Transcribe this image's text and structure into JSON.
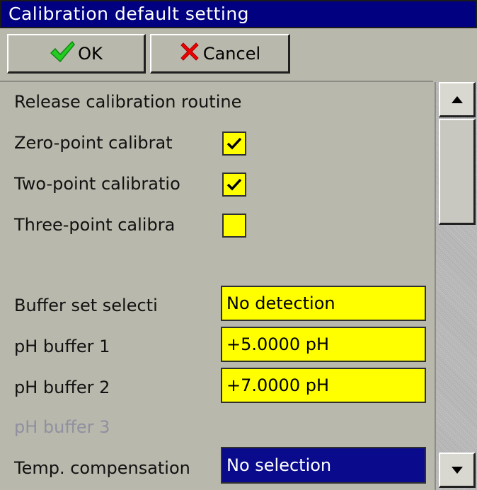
{
  "window": {
    "title": "Calibration default setting"
  },
  "toolbar": {
    "ok_label": "OK",
    "cancel_label": "Cancel"
  },
  "form": {
    "release_label": "Release calibration routine",
    "zero_point": {
      "label": "Zero-point calibrat",
      "checked": true
    },
    "two_point": {
      "label": "Two-point calibratio",
      "checked": true
    },
    "three_point": {
      "label": "Three-point calibra",
      "checked": false
    },
    "buffer_set": {
      "label": "Buffer set selecti",
      "value": "No detection"
    },
    "ph_buffer_1": {
      "label": "pH buffer 1",
      "value": "+5.0000 pH"
    },
    "ph_buffer_2": {
      "label": "pH buffer 2",
      "value": "+7.0000 pH"
    },
    "ph_buffer_3": {
      "label": "pH buffer 3"
    },
    "temp_comp": {
      "label": "Temp. compensation",
      "value": "No selection"
    }
  },
  "colors": {
    "title_bg": "#000080",
    "field_bg": "#ffff00",
    "selected_bg": "#0a0a8c",
    "panel_bg": "#b8b8ac",
    "ok_icon": "#22cc22",
    "cancel_icon": "#ee0000"
  },
  "icons": {
    "ok": "checkmark-icon",
    "cancel": "x-icon",
    "scroll_up": "arrow-up-icon",
    "scroll_down": "arrow-down-icon"
  }
}
